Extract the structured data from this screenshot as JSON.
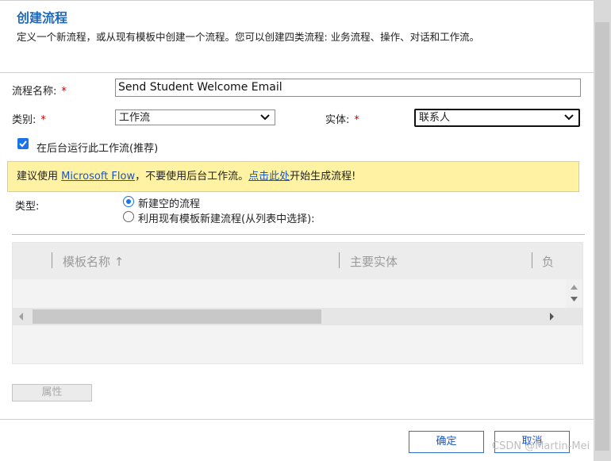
{
  "dialog": {
    "title": "创建流程",
    "subtitle": "定义一个新流程，或从现有模板中创建一个流程。您可以创建四类流程: 业务流程、操作、对话和工作流。"
  },
  "form": {
    "name_label": "流程名称:",
    "name_value": "Send Student Welcome Email",
    "category_label": "类别:",
    "category_value": "工作流",
    "entity_label": "实体:",
    "entity_value": "联系人",
    "required_mark": "*",
    "background_label": "在后台运行此工作流(推荐)",
    "background_checked": true
  },
  "banner": {
    "prefix": "建议使用 ",
    "link1": "Microsoft Flow",
    "middle": "，不要使用后台工作流。",
    "link2": "点击此处",
    "suffix": "开始生成流程!"
  },
  "type_section": {
    "label": "类型:",
    "options": [
      {
        "label": "新建空的流程",
        "selected": true
      },
      {
        "label": "利用现有模板新建流程(从列表中选择):",
        "selected": false
      }
    ]
  },
  "grid": {
    "columns": [
      "模板名称 ↑",
      "主要实体",
      "负"
    ]
  },
  "buttons": {
    "properties": "属性",
    "ok": "确定",
    "cancel": "取消"
  },
  "watermark": "CSDN @Martin-Mei",
  "colors": {
    "accent": "#1f6ab8",
    "link": "#1a55c2",
    "banner_bg": "#fff3a3",
    "required": "#cc0000"
  }
}
